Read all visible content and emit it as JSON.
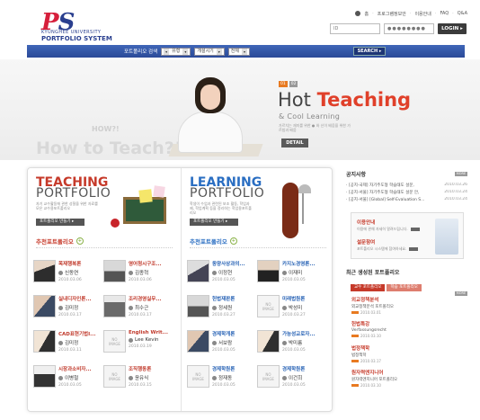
{
  "header": {
    "logo_mark_1": "P",
    "logo_mark_2": "S",
    "logo_university": "KYUNGHEE UNIVERSITY",
    "logo_system": "PORTFOLIO SYSTEM",
    "top_links": [
      "홈",
      "프로그램정보안",
      "이용안내",
      "FAQ",
      "Q&A"
    ],
    "login_id_placeholder": "ID",
    "login_pw_value": "●●●●●●●●",
    "login_button": "LOGIN"
  },
  "search": {
    "label": "포트폴리오 검색",
    "select_type": "유형",
    "select_period": "개설시기",
    "select_all": "전체",
    "button": "SEARCH"
  },
  "hero": {
    "bg_text": "How to Teach?!!",
    "bg_how": "HOW?!",
    "badge1": "01",
    "badge2": "02",
    "title_normal": "Hot ",
    "title_bold": "Teaching",
    "subtitle": "& Cool Learning",
    "desc": "가르치는 재미를 위한 ● 와 신이 배움을 위한 가르침과 배움",
    "detail_button": "DETAIL"
  },
  "teaching": {
    "title1": "TEACHING",
    "title2": "PORTFOLIO",
    "desc": "자기 교수활동에 관한 성찰을 위한 자료를 모은 교수용포트폴리오",
    "make_button": "포트폴리오 만들기 ▸",
    "rec_label": "추천포트폴리오",
    "items": [
      {
        "title": "목재행복론",
        "name": "신동연",
        "date": "2010.03.06",
        "img": "t1"
      },
      {
        "title": "영어청시구조...",
        "name": "김종혁",
        "date": "2010.03.06",
        "img": "t2"
      },
      {
        "title": "실내디자인론...",
        "name": "김미정",
        "date": "2010.03.17",
        "img": "t3"
      },
      {
        "title": "조리경영실무...",
        "name": "최수근",
        "date": "2010.03.17",
        "img": "t4"
      },
      {
        "title": "CAD표현기법I...",
        "name": "김미정",
        "date": "2010.03.11",
        "img": "t5"
      },
      {
        "title": "English Writ...",
        "name": "Lee Kevin",
        "date": "2010.03.19",
        "img": "noimg"
      },
      {
        "title": "시장과소비자...",
        "name": "이병철",
        "date": "2010.03.05",
        "img": "t6"
      },
      {
        "title": "조직행동론",
        "name": "윤유식",
        "date": "2010.03.15",
        "img": "noimg"
      }
    ]
  },
  "learning": {
    "title1": "LEARNING",
    "title2": "PORTFOLIO",
    "desc": "학생이 수업과 관련된 보조 활동, 학업과제, 학업계획 등을 정리하는 학업용포트폴리오",
    "make_button": "포트폴리오 만들기 ▸",
    "rec_label": "추천포트폴리오",
    "items": [
      {
        "title": "동양사상과의...",
        "name": "이정현",
        "date": "2010.03.05",
        "img": "t7"
      },
      {
        "title": "카지노경영론...",
        "name": "이재미",
        "date": "2010.03.05",
        "img": "t8"
      },
      {
        "title": "헌법재판론",
        "name": "정세원",
        "date": "2010.03.27",
        "img": "t2"
      },
      {
        "title": "미래법원론",
        "name": "박성미",
        "date": "2010.03.27",
        "img": "noimg"
      },
      {
        "title": "경제학개론",
        "name": "서보람",
        "date": "2010.03.05",
        "img": "t3"
      },
      {
        "title": "가능성교로자...",
        "name": "박미름",
        "date": "2010.03.05",
        "img": "t5"
      },
      {
        "title": "경제학원론",
        "name": "정재동",
        "date": "2010.03.05",
        "img": "noimg"
      },
      {
        "title": "경제학원론",
        "name": "이건희",
        "date": "2010.03.05",
        "img": "noimg"
      }
    ]
  },
  "notice": {
    "heading": "공지사항",
    "more": "MORE",
    "items": [
      {
        "text": "· [공지-국제] 자기주도형 학습태도 설문,",
        "date": "2010.03.26"
      },
      {
        "text": "· [공지-서울] 자기주도형 학습태도 설문 안,",
        "date": "2010.03.24"
      },
      {
        "text": "· [공지-서울] [Global] Self-Evaluation S...",
        "date": "2010.03.24"
      }
    ]
  },
  "guide": {
    "title1": "이용안내",
    "desc1": "이용에 관해 자세히 알려드립니다.",
    "title2": "설문참여",
    "desc2": "포트폴리오 시스템에 참여하세요."
  },
  "recent": {
    "heading": "최근 생성된 포트폴리오",
    "more": "MORE",
    "tab_teaching": "교수 포트폴리오",
    "tab_learning": "학습 포트폴리오",
    "items": [
      {
        "title": "외교정책분석",
        "sub": "외교정책분석 포트폴리오",
        "date": "2010.03.01"
      },
      {
        "title": "헌법특강",
        "sub": "Verfassungsrecht",
        "date": "2010.03.10"
      },
      {
        "title": "법정책학",
        "sub": "법정책학",
        "date": "2010.03.17"
      },
      {
        "title": "원자력엔지니어",
        "sub": "원자력엔지니어 포트폴리오",
        "date": "2010.03.10"
      }
    ]
  }
}
